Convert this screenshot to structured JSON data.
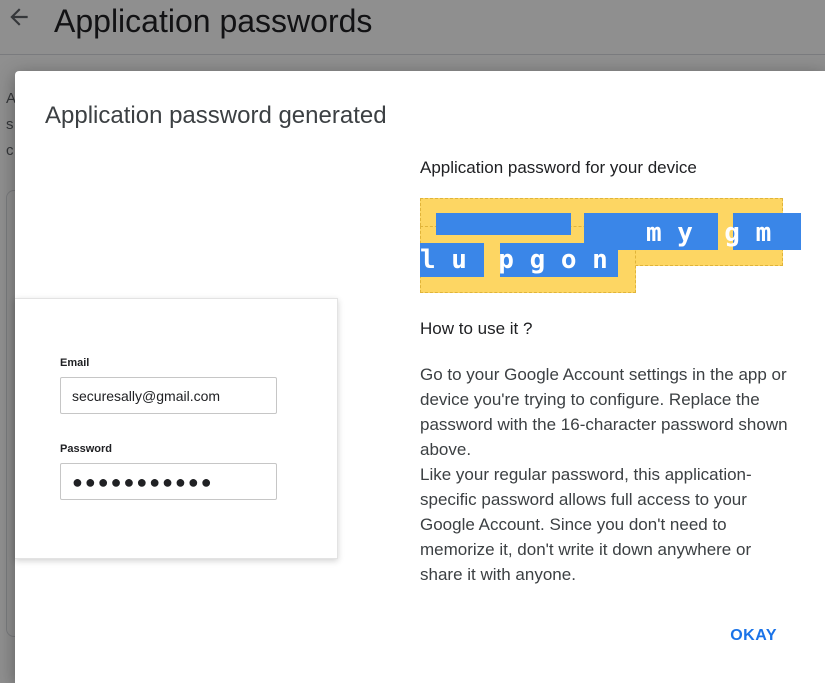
{
  "background": {
    "back_icon": "arrow-left-icon",
    "page_title": "Application passwords",
    "side_text_fragment": "A s c"
  },
  "dialog": {
    "title": "Application password generated",
    "illustration": {
      "email_label": "Email",
      "email_value": "securesally@gmail.com",
      "password_label": "Password",
      "password_value": "●●●●●●●●●●●"
    },
    "password_heading": "Application password for your device",
    "password_line1": "m y  g m",
    "password_line2": "l u  p g o n",
    "how_heading": "How to use it ?",
    "how_paragraph1": "Go to your Google Account settings in the app or device you're trying to configure. Replace the password with the 16-character password shown above.",
    "how_paragraph2": "Like your regular password, this application-specific password allows full access to your Google Account. Since you don't need to memorize it, don't write it down anywhere or share it with anyone.",
    "okay_label": "OKAY"
  },
  "colors": {
    "accent": "#1a73e8",
    "highlight": "#fdd663",
    "selection": "#3a86e8"
  }
}
